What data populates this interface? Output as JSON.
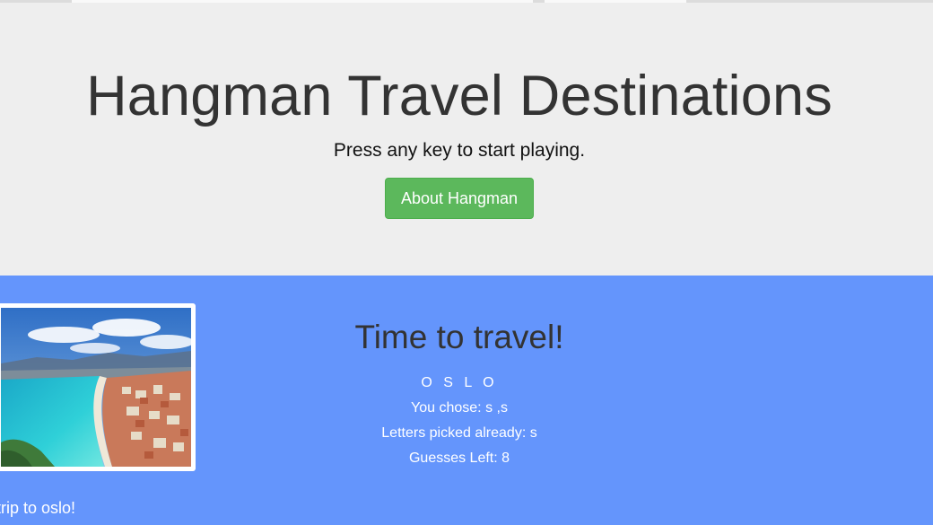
{
  "header": {
    "title": "Hangman Travel Destinations",
    "subtitle": "Press any key to start playing.",
    "about_button": "About Hangman"
  },
  "game": {
    "heading": "Time to travel!",
    "word_display": "O S L O",
    "chosen_line": "You chose: s ,s",
    "picked_line": "Letters picked already: s",
    "guesses_line": "Guesses Left: 8",
    "trip_message": "trip to oslo!"
  },
  "colors": {
    "jumbotron_bg": "#eeeeee",
    "game_bg": "#6495fc",
    "button_green": "#5cb85c"
  }
}
